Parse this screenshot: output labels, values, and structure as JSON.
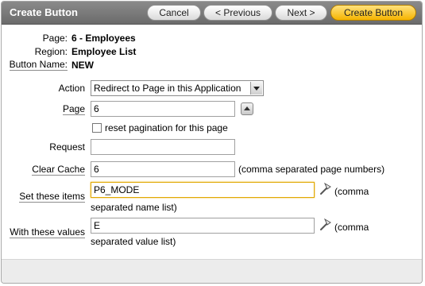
{
  "header": {
    "title": "Create Button",
    "cancel_label": "Cancel",
    "previous_label": "< Previous",
    "next_label": "Next >",
    "create_label": "Create Button"
  },
  "info": {
    "page_label": "Page:",
    "page_value": "6 - Employees",
    "region_label": "Region:",
    "region_value": "Employee List",
    "button_name_label": "Button Name:",
    "button_name_value": "NEW"
  },
  "form": {
    "action_label": "Action",
    "action_value": "Redirect to Page in this Application",
    "page_label": "Page",
    "page_value": "6",
    "reset_pagination_label": "reset pagination for this page",
    "reset_pagination_checked": false,
    "request_label": "Request",
    "request_value": "",
    "clear_cache_label": "Clear Cache",
    "clear_cache_value": "6",
    "clear_cache_hint": "(comma separated page numbers)",
    "set_items_label": "Set these items",
    "set_items_value": "P6_MODE",
    "set_items_hint_1": "(comma",
    "set_items_hint_2": "separated name list)",
    "with_values_label": "With these values",
    "with_values_value": "E",
    "with_values_hint_1": "(comma",
    "with_values_hint_2": "separated value list)"
  }
}
